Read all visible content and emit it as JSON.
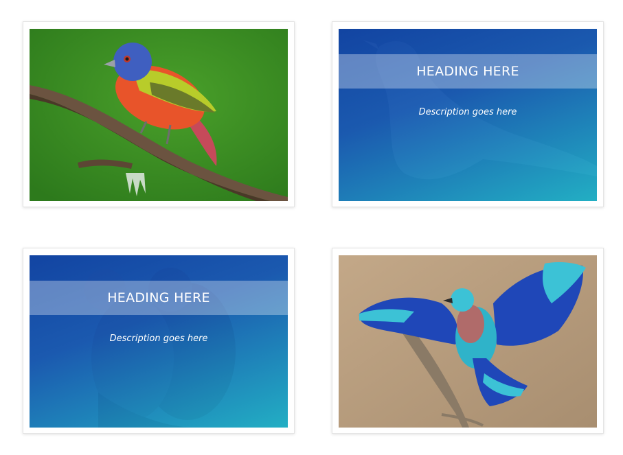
{
  "cards": [
    {
      "kind": "photo",
      "image": "painted-bunting-on-branch",
      "colors": {
        "background": "#3f8f22",
        "head": "#3f5fc0",
        "back": "#b8cc2a",
        "breast": "#e8542a",
        "branch": "#6b5340"
      }
    },
    {
      "kind": "caption",
      "image": "bird-silhouette",
      "heading": "HEADING HERE",
      "description": "Description goes here",
      "colors": {
        "gradient_start": "#0c3ca0",
        "gradient_end": "#1cb9c8"
      }
    },
    {
      "kind": "caption",
      "image": "perched-bird-silhouette",
      "heading": "HEADING HERE",
      "description": "Description goes here",
      "colors": {
        "gradient_start": "#0c3ca0",
        "gradient_end": "#1cb9c8"
      }
    },
    {
      "kind": "photo",
      "image": "indian-roller-wings-spread",
      "colors": {
        "background": "#b59a7c",
        "wing": "#1f47b8",
        "wing_light": "#3cc2d6",
        "breast": "#b06b6a",
        "branch": "#8a7a66"
      }
    }
  ]
}
